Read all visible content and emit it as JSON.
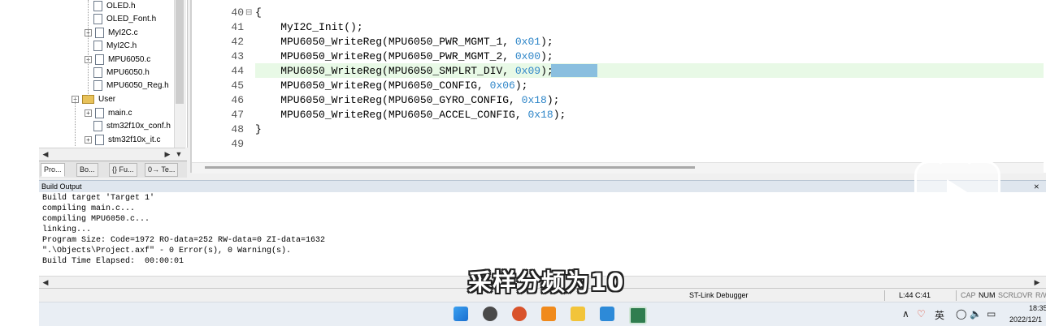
{
  "project_tree": {
    "items": [
      {
        "label": "OLED.h",
        "expander": ""
      },
      {
        "label": "OLED_Font.h",
        "expander": ""
      },
      {
        "label": "MyI2C.c",
        "expander": "+"
      },
      {
        "label": "MyI2C.h",
        "expander": ""
      },
      {
        "label": "MPU6050.c",
        "expander": "+"
      },
      {
        "label": "MPU6050.h",
        "expander": ""
      },
      {
        "label": "MPU6050_Reg.h",
        "expander": ""
      },
      {
        "label": "User",
        "expander": "−"
      },
      {
        "label": "main.c",
        "expander": "+"
      },
      {
        "label": "stm32f10x_conf.h",
        "expander": ""
      },
      {
        "label": "stm32f10x_it.c",
        "expander": "+"
      }
    ],
    "tabs": [
      "Pro...",
      "Bo...",
      "{} Fu...",
      "0→ Te..."
    ]
  },
  "editor": {
    "lines": [
      {
        "num": "40",
        "fold": "⊟",
        "parts": [
          {
            "t": "{",
            "c": ""
          }
        ]
      },
      {
        "num": "41",
        "fold": "",
        "parts": [
          {
            "t": "    MyI2C_Init();",
            "c": ""
          }
        ]
      },
      {
        "num": "42",
        "fold": "",
        "parts": [
          {
            "t": "    MPU6050_WriteReg(MPU6050_PWR_MGMT_1, ",
            "c": ""
          },
          {
            "t": "0x01",
            "c": "hex"
          },
          {
            "t": ");",
            "c": ""
          }
        ]
      },
      {
        "num": "43",
        "fold": "",
        "parts": [
          {
            "t": "    MPU6050_WriteReg(MPU6050_PWR_MGMT_2, ",
            "c": ""
          },
          {
            "t": "0x00",
            "c": "hex"
          },
          {
            "t": ");",
            "c": ""
          }
        ]
      },
      {
        "num": "44",
        "fold": "",
        "parts": [
          {
            "t": "    MPU6050_WriteReg(MPU6050_SMPLRT_DIV, ",
            "c": ""
          },
          {
            "t": "0x09",
            "c": "hex"
          },
          {
            "t": ");",
            "c": ""
          }
        ]
      },
      {
        "num": "45",
        "fold": "",
        "parts": [
          {
            "t": "    MPU6050_WriteReg(MPU6050_CONFIG, ",
            "c": ""
          },
          {
            "t": "0x06",
            "c": "hex"
          },
          {
            "t": ");",
            "c": ""
          }
        ]
      },
      {
        "num": "46",
        "fold": "",
        "parts": [
          {
            "t": "    MPU6050_WriteReg(MPU6050_GYRO_CONFIG, ",
            "c": ""
          },
          {
            "t": "0x18",
            "c": "hex"
          },
          {
            "t": ");",
            "c": ""
          }
        ]
      },
      {
        "num": "47",
        "fold": "",
        "parts": [
          {
            "t": "    MPU6050_WriteReg(MPU6050_ACCEL_CONFIG, ",
            "c": ""
          },
          {
            "t": "0x18",
            "c": "hex"
          },
          {
            "t": ");",
            "c": ""
          }
        ]
      },
      {
        "num": "48",
        "fold": "",
        "parts": [
          {
            "t": "}",
            "c": ""
          }
        ]
      },
      {
        "num": "49",
        "fold": "",
        "parts": [
          {
            "t": "",
            "c": ""
          }
        ]
      }
    ]
  },
  "build_output": {
    "title": "Build Output",
    "pin": "⨯",
    "lines": [
      "Build target 'Target 1'",
      "compiling main.c...",
      "compiling MPU6050.c...",
      "linking...",
      "Program Size: Code=1972 RO-data=252 RW-data=0 ZI-data=1632",
      "\".\\Objects\\Project.axf\" - 0 Error(s), 0 Warning(s).",
      "Build Time Elapsed:  00:00:01"
    ]
  },
  "status_bar": {
    "debugger": "ST-Link Debugger",
    "position": "L:44 C:41",
    "cap": "CAP",
    "num": "NUM",
    "scrl": "SCRL",
    "ovr": "OVR",
    "rw": "R/W"
  },
  "subtitle": "采样分频为10",
  "taskbar": {
    "tray_ime": "英",
    "clock_time": "18:35",
    "clock_date": "2022/12/1"
  },
  "colors": {
    "hex_literal": "#2f86c8",
    "current_line": "#e8f9e6",
    "selection": "#3d8fd9"
  }
}
